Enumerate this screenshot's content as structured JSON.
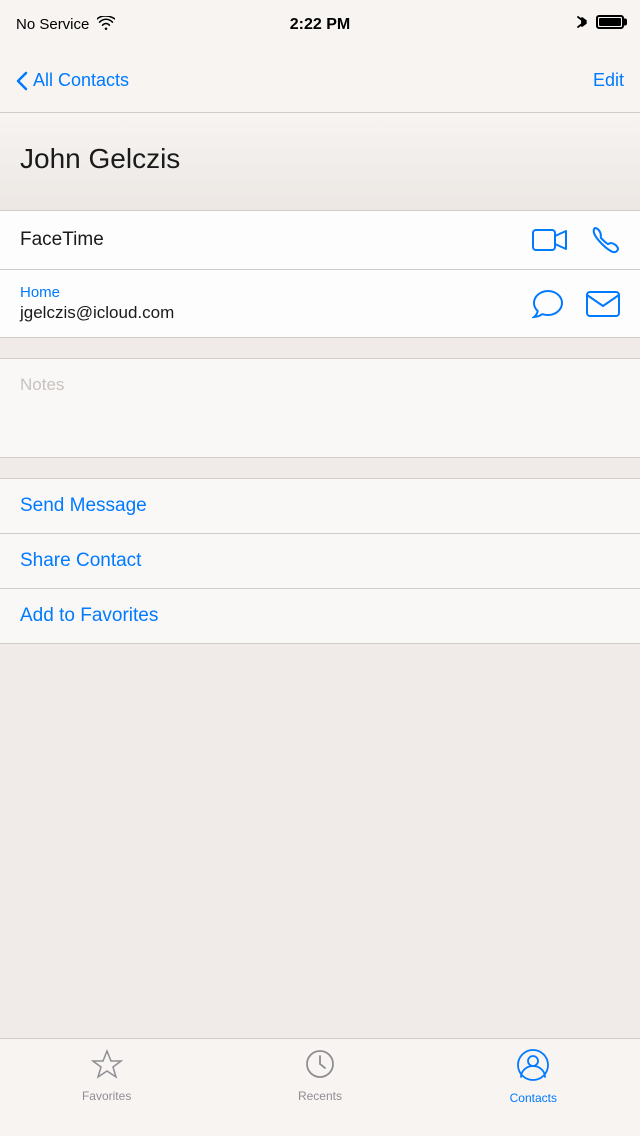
{
  "statusBar": {
    "carrier": "No Service",
    "time": "2:22 PM"
  },
  "navBar": {
    "backLabel": "All Contacts",
    "editLabel": "Edit"
  },
  "contact": {
    "name": "John Gelczis"
  },
  "facetimeRow": {
    "label": "FaceTime"
  },
  "emailRow": {
    "typeLabel": "Home",
    "email": "jgelczis@icloud.com"
  },
  "notesRow": {
    "placeholder": "Notes"
  },
  "actions": [
    {
      "label": "Send Message"
    },
    {
      "label": "Share Contact"
    },
    {
      "label": "Add to Favorites"
    }
  ],
  "tabBar": {
    "tabs": [
      {
        "label": "Favorites",
        "icon": "star",
        "active": false
      },
      {
        "label": "Recents",
        "icon": "clock",
        "active": false
      },
      {
        "label": "Contacts",
        "icon": "person",
        "active": true
      }
    ]
  }
}
